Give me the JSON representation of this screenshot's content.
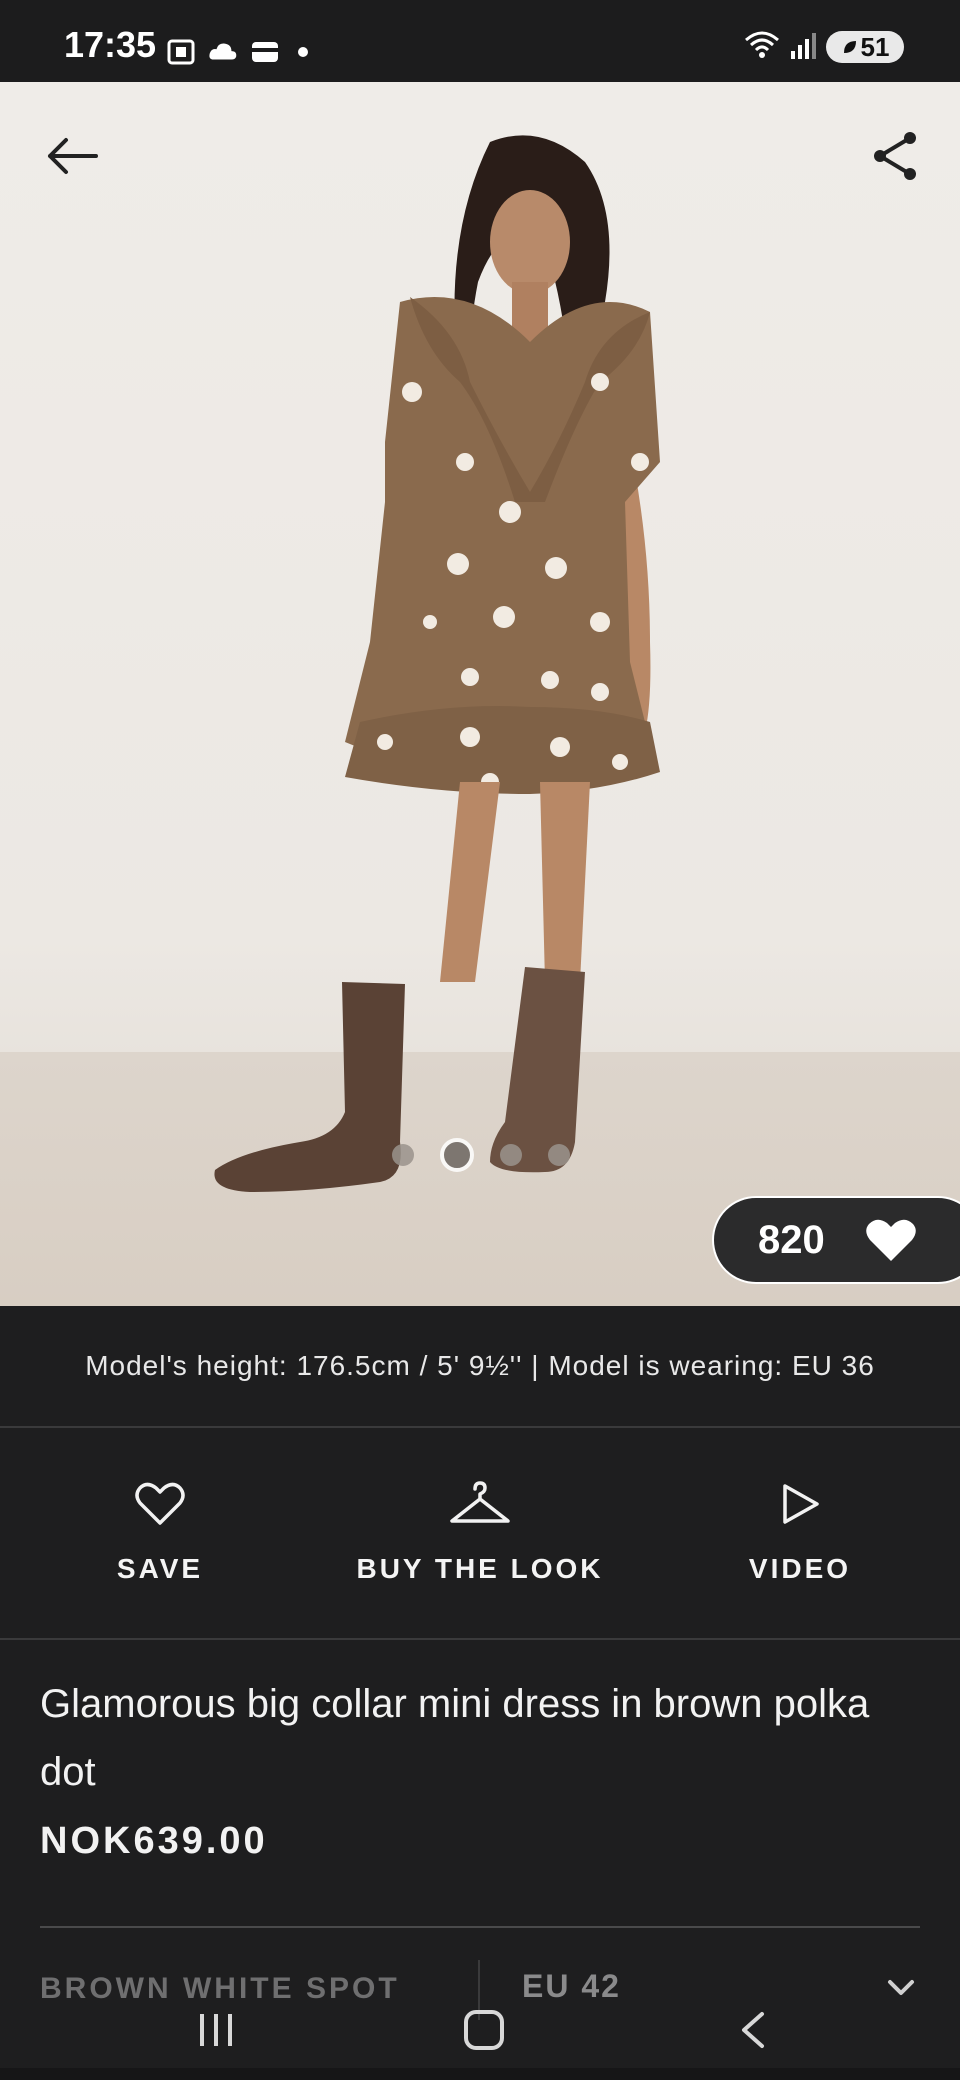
{
  "status_bar": {
    "time": "17:35",
    "battery": "51",
    "icons": [
      "screenshot-icon",
      "cloud-icon",
      "wallet-icon",
      "wifi-icon",
      "signal-icon"
    ]
  },
  "hero": {
    "image_alt_icon": "dress-photo",
    "active_slide": 2,
    "total_slides": 4,
    "likes": "820"
  },
  "model_info": "Model's height: 176.5cm / 5' 9½'' | Model is wearing: EU 36",
  "actions": [
    {
      "label": "SAVE",
      "icon": "heart-outline-icon"
    },
    {
      "label": "BUY THE LOOK",
      "icon": "hanger-icon"
    },
    {
      "label": "VIDEO",
      "icon": "play-icon"
    }
  ],
  "product": {
    "title": "Glamorous big collar mini dress in brown polka dot",
    "price": "NOK639.00"
  },
  "selectors": {
    "colour": "BROWN WHITE SPOT",
    "size": "EU 42"
  },
  "colors": {
    "background": "#1e1e1f",
    "accent": "#ffffff"
  }
}
